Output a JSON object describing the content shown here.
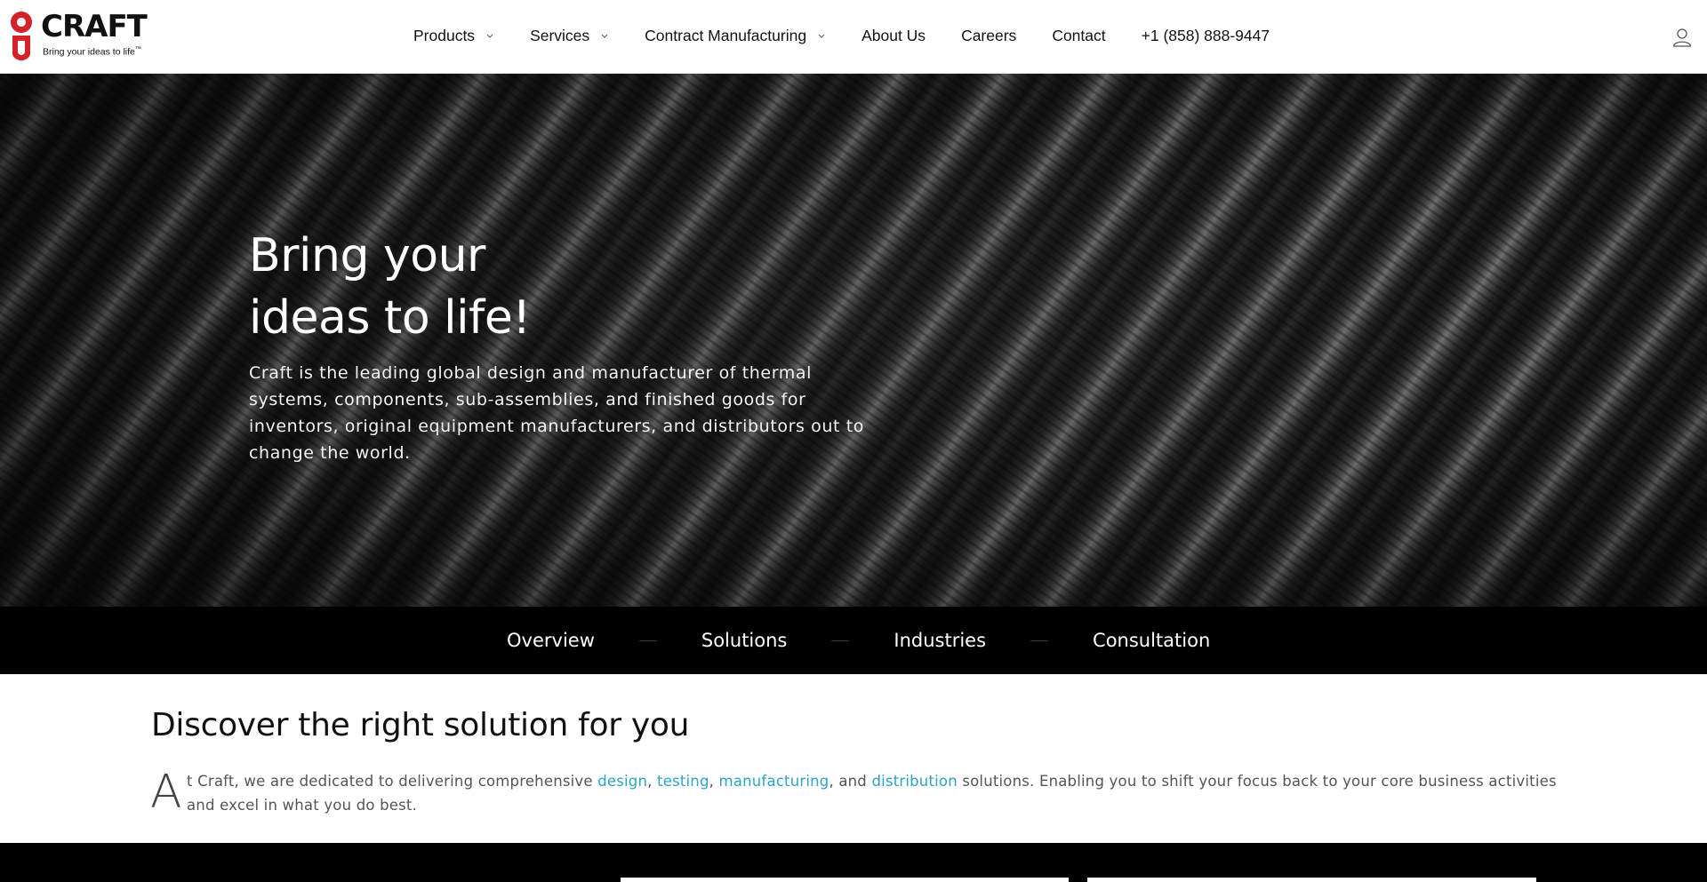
{
  "header": {
    "logo": {
      "wordmark": "CRAFT",
      "tagline": "Bring your ideas to life",
      "trademark": "™",
      "brand_color": "#d3222a"
    },
    "nav": [
      {
        "label": "Products",
        "has_dropdown": true
      },
      {
        "label": "Services",
        "has_dropdown": true
      },
      {
        "label": "Contract Manufacturing",
        "has_dropdown": true
      },
      {
        "label": "About Us",
        "has_dropdown": false
      },
      {
        "label": "Careers",
        "has_dropdown": false
      },
      {
        "label": "Contact",
        "has_dropdown": false
      }
    ],
    "phone": "+1 (858) 888-9447",
    "account_icon": "user-icon"
  },
  "hero": {
    "title_line1": "Bring your",
    "title_line2": "ideas to life!",
    "description": "Craft is the leading global design and manufacturer of thermal systems, components, sub-assemblies, and finished goods for inventors, original equipment manufacturers, and distributors out to change the world."
  },
  "tabs": [
    {
      "label": "Overview"
    },
    {
      "label": "Solutions"
    },
    {
      "label": "Industries"
    },
    {
      "label": "Consultation"
    }
  ],
  "discover": {
    "title": "Discover the right solution for you",
    "drop_cap": "A",
    "text_start": "t Craft, we are dedicated to delivering comprehensive ",
    "link_design": "design",
    "sep1": ", ",
    "link_testing": "testing",
    "sep2": ", ",
    "link_manufacturing": "manufacturing",
    "sep3": ", and ",
    "link_distribution": "distribution",
    "text_end": " solutions. Enabling you to shift your focus back to your core business activities and excel in what you do best.",
    "link_color": "#2ea3c6"
  }
}
